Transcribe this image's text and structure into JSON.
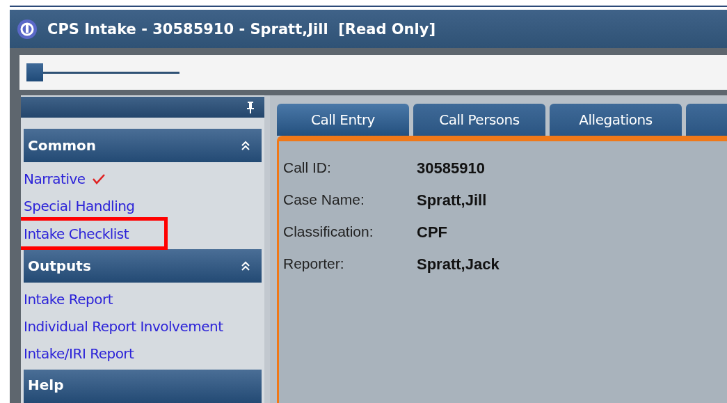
{
  "window": {
    "title": "CPS Intake - 30585910 - Spratt,Jill  [Read Only]"
  },
  "toolbar": {
    "slider": {
      "level": 0
    }
  },
  "sidebar": {
    "sections": [
      {
        "title": "Common",
        "expanded": true,
        "items": [
          {
            "label": "Narrative",
            "checked": true,
            "highlighted": false
          },
          {
            "label": "Special Handling",
            "checked": false,
            "highlighted": false
          },
          {
            "label": "Intake Checklist",
            "checked": false,
            "highlighted": true
          }
        ]
      },
      {
        "title": "Outputs",
        "expanded": true,
        "items": [
          {
            "label": "Intake Report",
            "checked": false,
            "highlighted": false
          },
          {
            "label": "Individual Report Involvement",
            "checked": false,
            "highlighted": false
          },
          {
            "label": "Intake/IRI Report",
            "checked": false,
            "highlighted": false
          }
        ]
      },
      {
        "title": "Help"
      }
    ]
  },
  "tabs": [
    {
      "label": "Call Entry",
      "selected": true
    },
    {
      "label": "Call Persons",
      "selected": false
    },
    {
      "label": "Allegations",
      "selected": false
    },
    {
      "selected": false
    }
  ],
  "fields": [
    {
      "label": "Call ID:",
      "value": "30585910"
    },
    {
      "label": "Case Name:",
      "value": "Spratt,Jill"
    },
    {
      "label": "Classification:",
      "value": "CPF"
    },
    {
      "label": "Reporter:",
      "value": "Spratt,Jack"
    }
  ]
}
